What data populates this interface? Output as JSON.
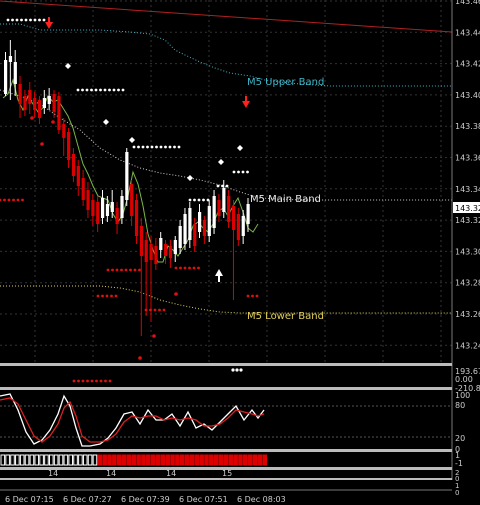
{
  "main": {
    "price_axis_labels": [
      "143.46",
      "143.44",
      "143.42",
      "143.40",
      "143.38",
      "143.36",
      "143.34",
      "143.32",
      "143.30",
      "143.28",
      "143.26",
      "143.24"
    ],
    "current_price": "143.32",
    "bands": {
      "upper_label": "M5 Upper Band",
      "main_label": "M5 Main Band",
      "lower_label": "M5 Lower Band"
    },
    "colors": {
      "background": "#000000",
      "bull_candle": "#ffffff",
      "bear_candle": "#dd0000",
      "upper_band": "#3fb6c8",
      "main_band": "#e8e8e8",
      "lower_band": "#e3d05a",
      "grid": "#3a3a3a",
      "signal_dots": "#e01010",
      "sell_arrow": "#ff2020",
      "buy_arrow": "#ffffff"
    }
  },
  "indicator1": {
    "axis_labels": [
      "193.67",
      "0.00",
      "-210.88"
    ]
  },
  "stochastic": {
    "axis_labels": [
      "100",
      "80",
      "20",
      "0"
    ]
  },
  "histogram": {
    "axis_labels": [
      "1",
      "-1"
    ],
    "hour_labels": [
      "14",
      "14",
      "14",
      "14",
      "15"
    ]
  },
  "panel4": {
    "axis_labels": [
      "2",
      "0"
    ]
  },
  "panel5": {
    "axis_labels": [
      "1",
      "0"
    ]
  },
  "time_axis": {
    "labels": [
      "6 Dec 07:15",
      "6 Dec 07:27",
      "6 Dec 07:39",
      "6 Dec 07:51",
      "6 Dec 08:03"
    ]
  }
}
